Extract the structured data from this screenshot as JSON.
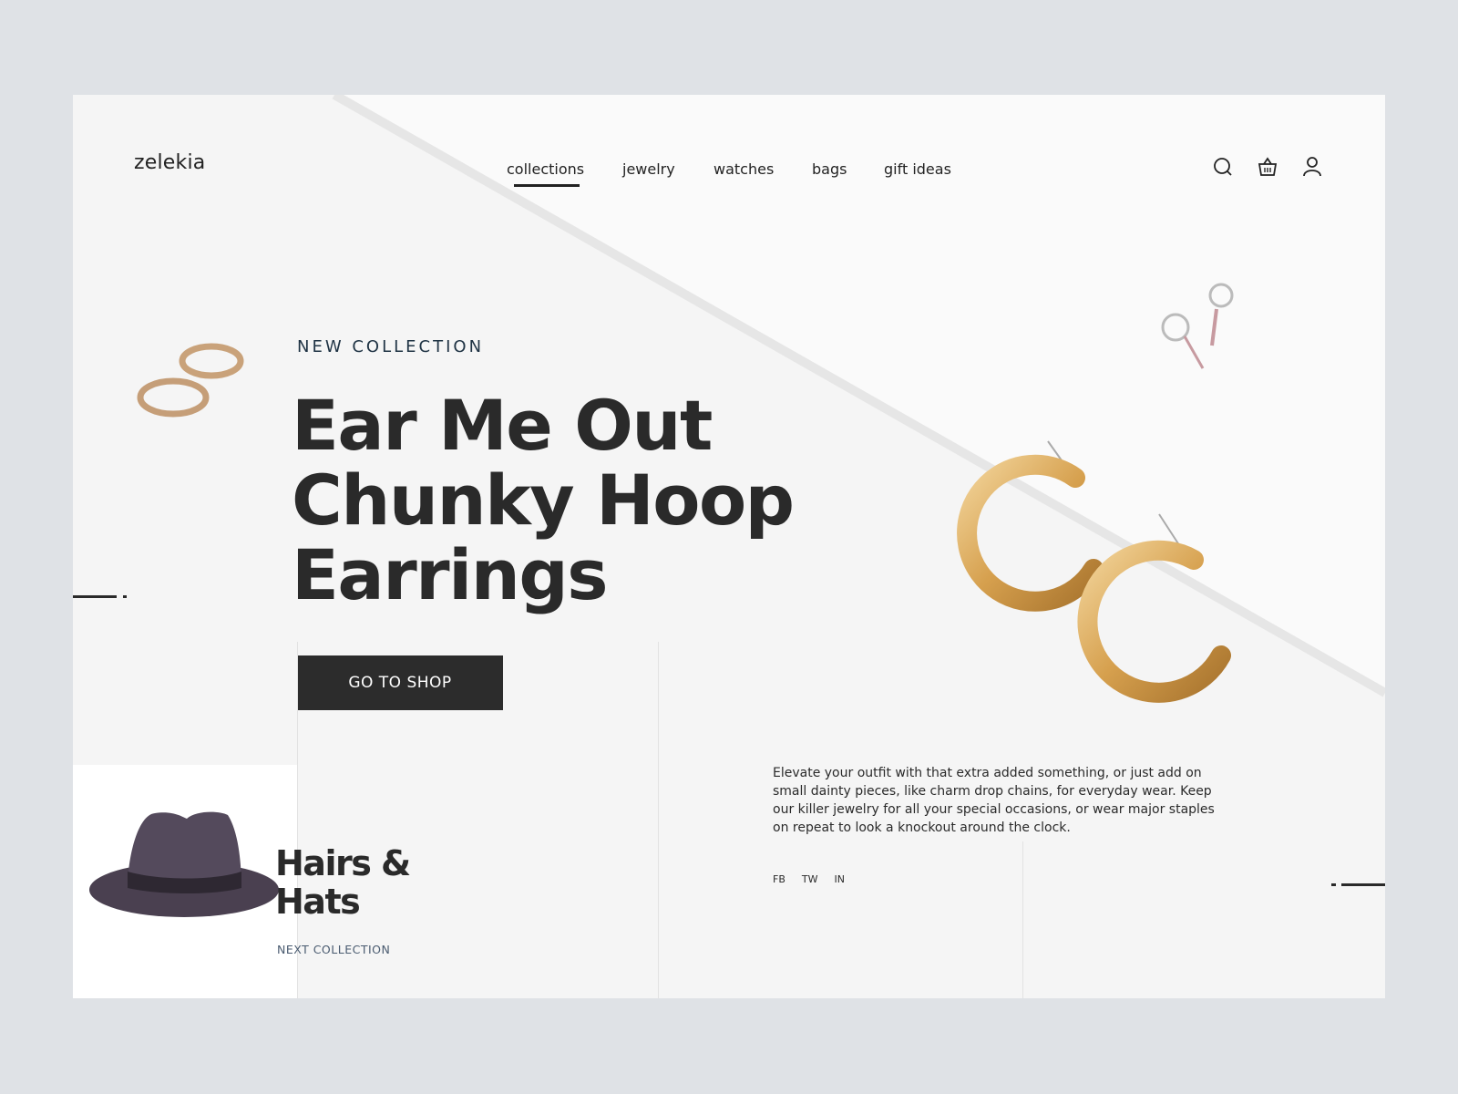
{
  "brand": {
    "logo": "zelekia"
  },
  "nav": {
    "items": [
      {
        "label": "collections",
        "active": true
      },
      {
        "label": "jewelry"
      },
      {
        "label": "watches"
      },
      {
        "label": "bags"
      },
      {
        "label": "gift ideas"
      }
    ]
  },
  "header_icons": [
    "search-icon",
    "basket-icon",
    "user-icon"
  ],
  "hero": {
    "eyebrow": "NEW COLLECTION",
    "title_lines": [
      "Ear Me Out",
      "Chunky Hoop",
      "Earrings"
    ],
    "cta_label": "GO TO SHOP",
    "description": "Elevate your outfit with that extra added something, or just add on small dainty pieces, like charm drop chains, for everyday wear. Keep our killer jewelry for all your special occasions, or wear major staples on repeat to look a knockout around the clock."
  },
  "social": [
    "FB",
    "TW",
    "IN"
  ],
  "next_collection": {
    "title_lines": [
      "Hairs &",
      "Hats"
    ],
    "label": "NEXT COLLECTION"
  },
  "colors": {
    "background": "#dfe2e6",
    "card": "#f5f5f5",
    "dark": "#2c2c2c",
    "accent_text": "#1f3344",
    "gold": "#d9a85a",
    "hat": "#4a4050"
  }
}
